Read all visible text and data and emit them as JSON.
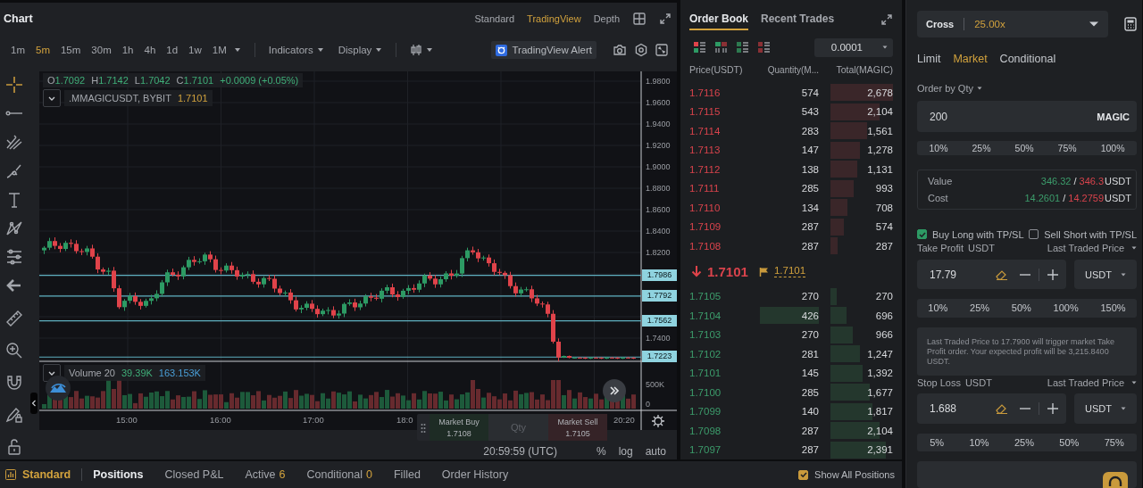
{
  "chart_panel": {
    "title": "Chart",
    "view_tabs": [
      {
        "label": "Standard",
        "selected": false
      },
      {
        "label": "TradingView",
        "selected": true
      },
      {
        "label": "Depth",
        "selected": false
      }
    ],
    "intervals": [
      {
        "label": "1m",
        "selected": false
      },
      {
        "label": "5m",
        "selected": true
      },
      {
        "label": "15m",
        "selected": false
      },
      {
        "label": "30m",
        "selected": false
      },
      {
        "label": "1h",
        "selected": false
      },
      {
        "label": "4h",
        "selected": false
      },
      {
        "label": "1d",
        "selected": false
      },
      {
        "label": "1w",
        "selected": false
      },
      {
        "label": "1M",
        "selected": false
      }
    ],
    "menus": [
      {
        "label": "Indicators"
      },
      {
        "label": "Display"
      }
    ],
    "alert_button": "TradingView Alert",
    "legend": {
      "ohlc": [
        {
          "key": "O",
          "value": "1.7092"
        },
        {
          "key": "H",
          "value": "1.7142"
        },
        {
          "key": "L",
          "value": "1.7042"
        },
        {
          "key": "C",
          "value": "1.7101"
        }
      ],
      "change": "+0.0009 (+0.05%)"
    },
    "symbol": {
      "name": ".MMAGICUSDT, BYBIT",
      "price": "1.7101"
    },
    "price_axis": [
      "1.9800",
      "1.9600",
      "1.9400",
      "1.9200",
      "1.9000",
      "1.8800",
      "1.8600",
      "1.8400",
      "1.8200",
      "1.7400"
    ],
    "price_lines": [
      {
        "label": "1.7986"
      },
      {
        "label": "1.7792"
      },
      {
        "label": "1.7562"
      },
      {
        "label": "1.7223"
      }
    ],
    "volume_legend": {
      "name": "Volume 20",
      "value_1": "39.39K",
      "value_2": "163.153K"
    },
    "volume_axis": [
      "500K",
      "0"
    ],
    "time_axis": [
      "15:00",
      "16:00",
      "17:00",
      "18:0",
      "20:20"
    ],
    "quick_trade": {
      "buy": {
        "label": "Market Buy",
        "price": "1.7108"
      },
      "qty_placeholder": "Qty",
      "sell": {
        "label": "Market Sell",
        "price": "1.7105"
      }
    },
    "footer": {
      "clock": "20:59:59 (UTC)",
      "options": [
        "%",
        "log",
        "auto"
      ]
    }
  },
  "order_book": {
    "tabs": [
      {
        "label": "Order Book",
        "selected": true
      },
      {
        "label": "Recent Trades",
        "selected": false
      }
    ],
    "precision": "0.0001",
    "columns": [
      "Price(USDT)",
      "Quantity(M...",
      "Total(MAGIC)"
    ],
    "asks": [
      {
        "price": "1.7116",
        "qty": "574",
        "total": "2,678"
      },
      {
        "price": "1.7115",
        "qty": "543",
        "total": "2,104"
      },
      {
        "price": "1.7114",
        "qty": "283",
        "total": "1,561"
      },
      {
        "price": "1.7113",
        "qty": "147",
        "total": "1,278"
      },
      {
        "price": "1.7112",
        "qty": "138",
        "total": "1,131"
      },
      {
        "price": "1.7111",
        "qty": "285",
        "total": "993"
      },
      {
        "price": "1.7110",
        "qty": "134",
        "total": "708"
      },
      {
        "price": "1.7109",
        "qty": "287",
        "total": "574"
      },
      {
        "price": "1.7108",
        "qty": "287",
        "total": "287"
      }
    ],
    "last_price": {
      "price": "1.7101",
      "mark_price": "1.7101"
    },
    "bids": [
      {
        "price": "1.7105",
        "qty": "270",
        "total": "270",
        "large_order": false
      },
      {
        "price": "1.7104",
        "qty": "426",
        "total": "696",
        "large_order": true
      },
      {
        "price": "1.7103",
        "qty": "270",
        "total": "966",
        "large_order": false
      },
      {
        "price": "1.7102",
        "qty": "281",
        "total": "1,247",
        "large_order": false
      },
      {
        "price": "1.7101",
        "qty": "145",
        "total": "1,392",
        "large_order": false
      },
      {
        "price": "1.7100",
        "qty": "285",
        "total": "1,677",
        "large_order": false
      },
      {
        "price": "1.7099",
        "qty": "140",
        "total": "1,817",
        "large_order": false
      },
      {
        "price": "1.7098",
        "qty": "287",
        "total": "2,104",
        "large_order": false
      },
      {
        "price": "1.7097",
        "qty": "287",
        "total": "2,391",
        "large_order": false
      }
    ]
  },
  "bottom_bar": {
    "mode": "Standard",
    "tabs": [
      {
        "label": "Positions",
        "selected": true
      },
      {
        "label": "Closed P&L",
        "selected": false
      },
      {
        "label": "Active",
        "count": "6",
        "selected": false
      },
      {
        "label": "Conditional",
        "count": "0",
        "selected": false
      },
      {
        "label": "Filled",
        "selected": false
      },
      {
        "label": "Order History",
        "selected": false
      }
    ],
    "show_all": {
      "label": "Show All Positions",
      "checked": true
    }
  },
  "order_form": {
    "margin_mode": "Cross",
    "leverage": "25.00x",
    "order_types": [
      {
        "label": "Limit",
        "selected": false
      },
      {
        "label": "Market",
        "selected": true
      },
      {
        "label": "Conditional",
        "selected": false
      }
    ],
    "qty_mode": "Order by Qty",
    "qty": {
      "value": "200",
      "unit": "MAGIC"
    },
    "qty_percents": [
      "10%",
      "25%",
      "50%",
      "75%",
      "100%"
    ],
    "summary": [
      {
        "label": "Value",
        "buy": "346.32",
        "separator": "/",
        "sell": "346.3",
        "unit": "USDT"
      },
      {
        "label": "Cost",
        "buy": "14.2601",
        "separator": "/",
        "sell": "14.2759",
        "unit": "USDT"
      }
    ],
    "tpsl_options": [
      {
        "label": "Buy Long with TP/SL",
        "checked": true
      },
      {
        "label": "Sell Short with TP/SL",
        "checked": false
      }
    ],
    "take_profit": {
      "label": "Take Profit",
      "unit": "USDT",
      "trigger": "Last Traded Price",
      "value": "17.79",
      "currency": "USDT",
      "percents": [
        "10%",
        "25%",
        "50%",
        "100%",
        "150%"
      ],
      "note": "Last Traded Price to 17.7900 will trigger market Take Profit order. Your expected profit will be 3,215.8400 USDT."
    },
    "stop_loss": {
      "label": "Stop Loss",
      "unit": "USDT",
      "trigger": "Last Traded Price",
      "value": "1.688",
      "currency": "USDT",
      "percents": [
        "5%",
        "10%",
        "25%",
        "50%",
        "75%"
      ]
    }
  }
}
